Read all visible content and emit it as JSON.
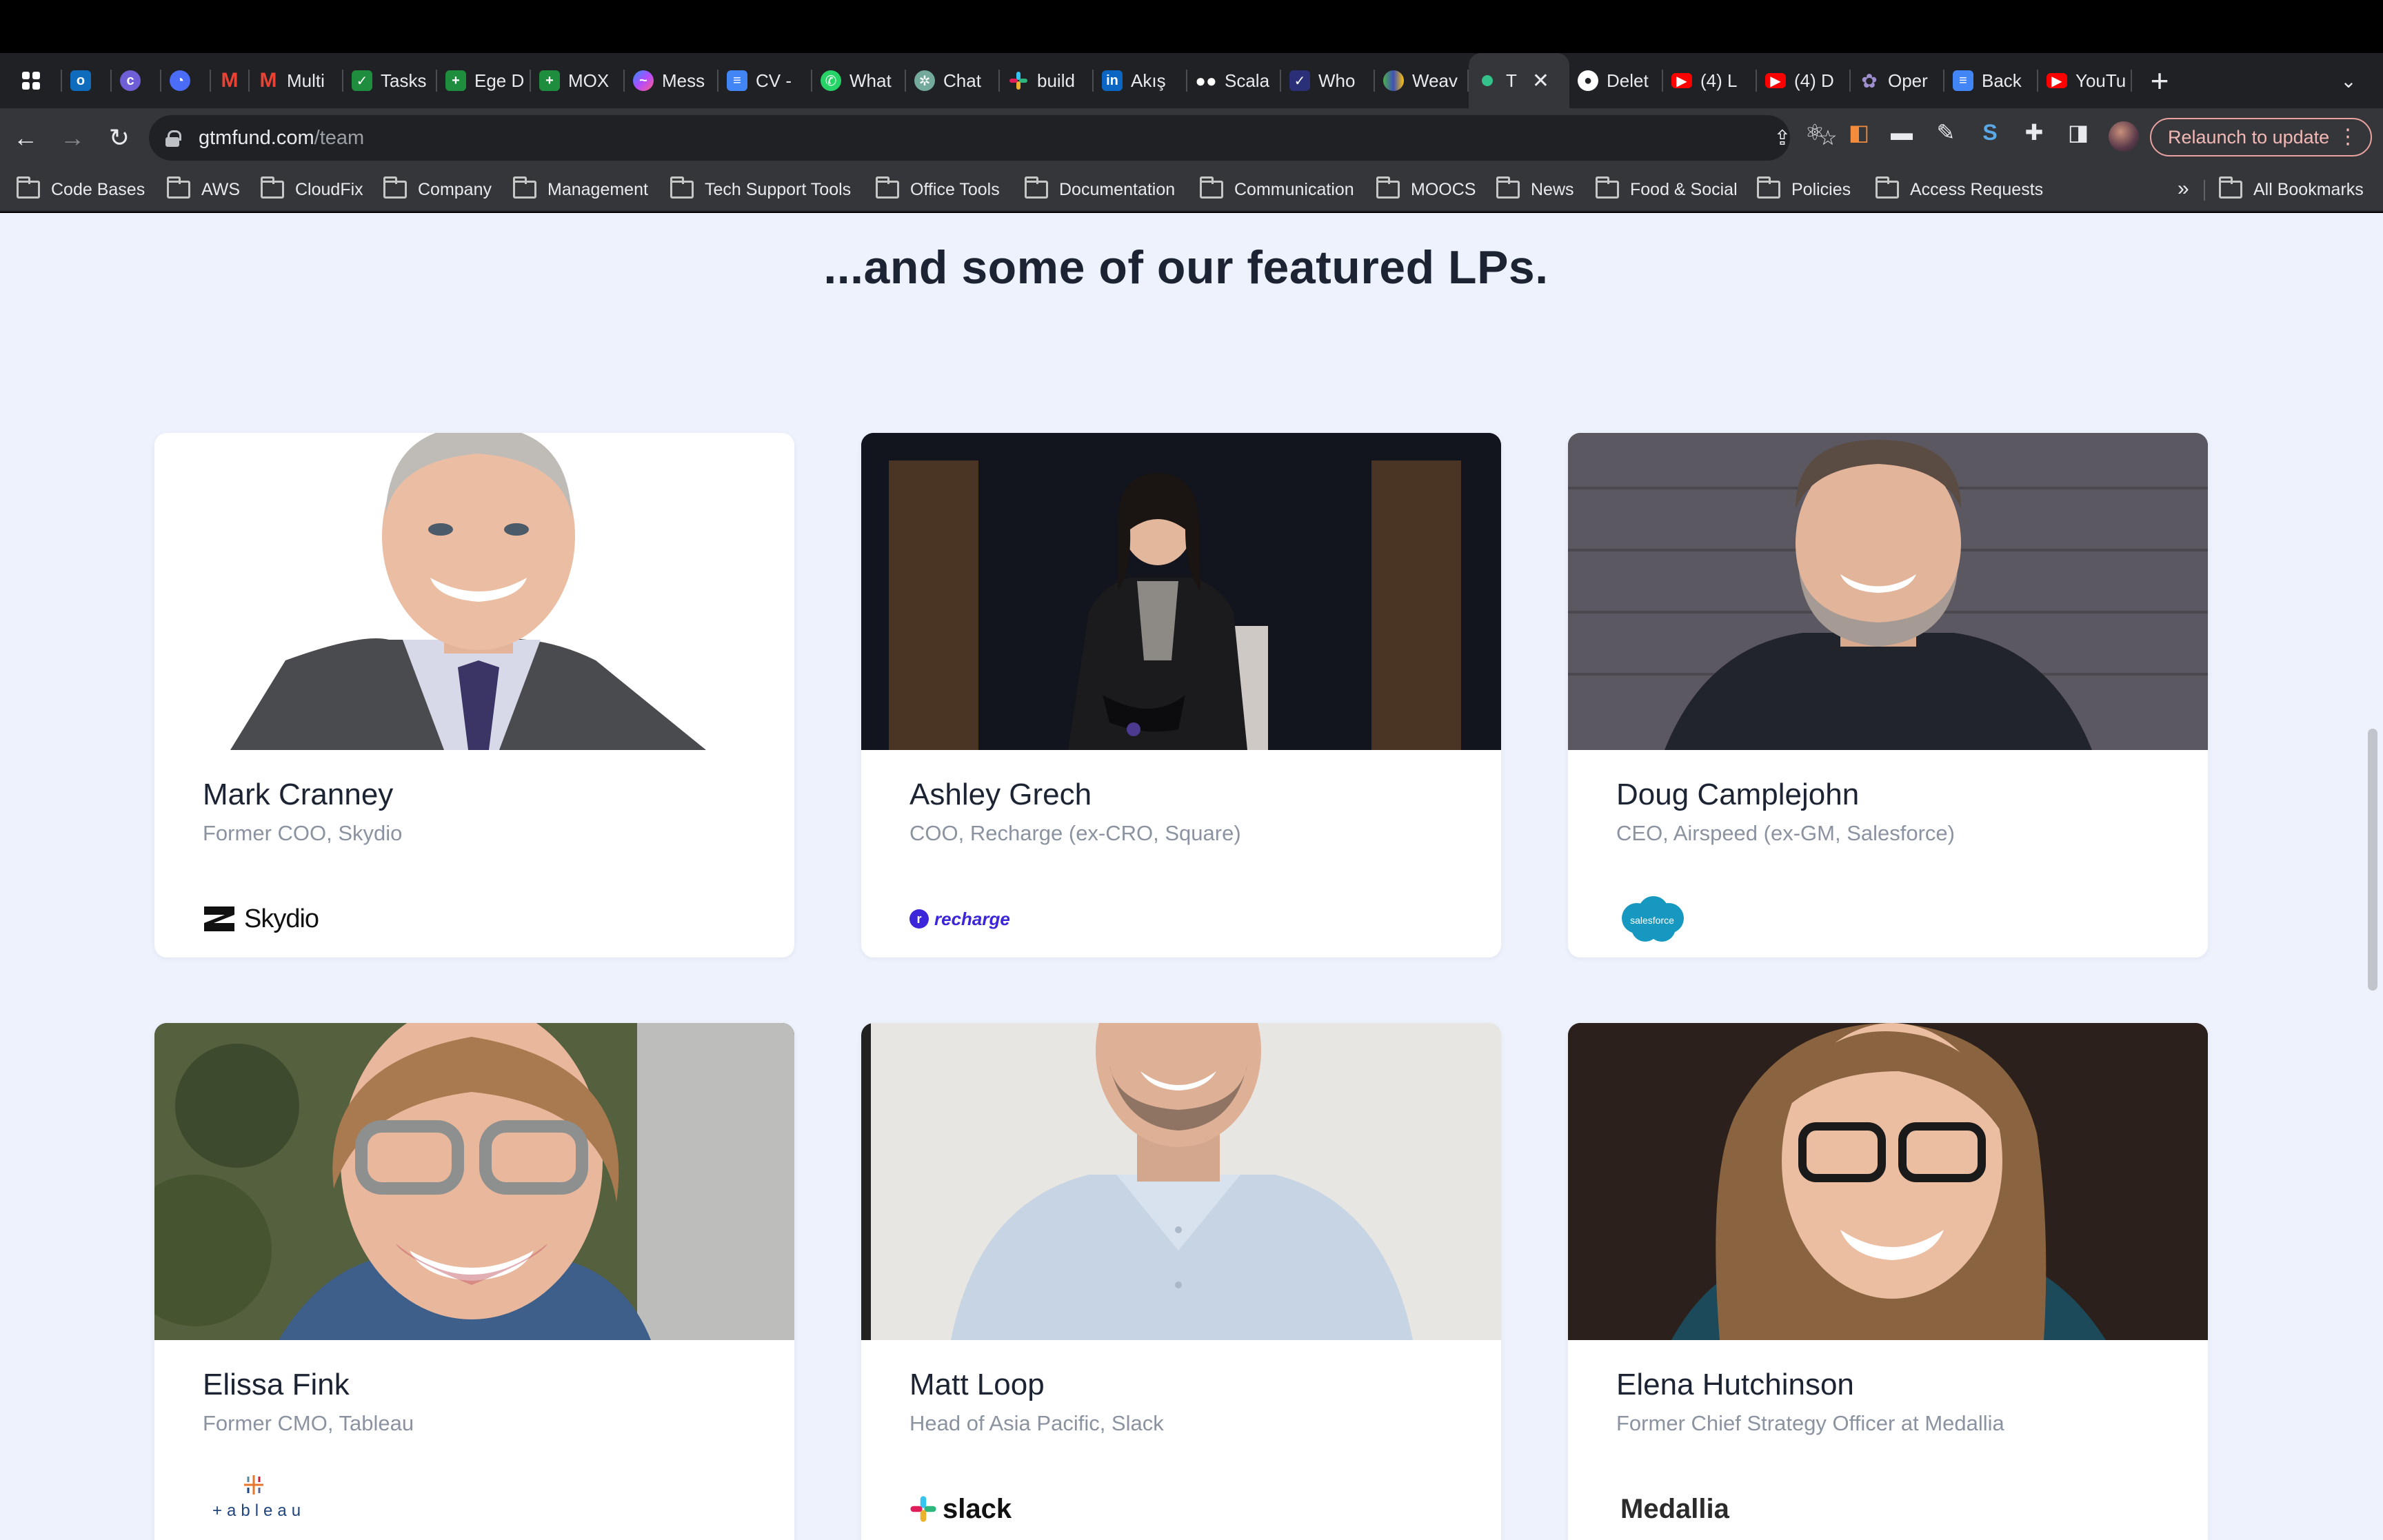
{
  "browser": {
    "tabs": [
      {
        "label": "",
        "icon": "apps-grid-icon",
        "color": "#ffffff"
      },
      {
        "label": "",
        "icon": "outlook-icon",
        "color": "#0f6cbd"
      },
      {
        "label": "",
        "icon": "circle-app-icon",
        "color": "#7b6cf0"
      },
      {
        "label": "",
        "icon": "clockify-icon",
        "color": "#4a6cf7"
      },
      {
        "label": "",
        "icon": "gmail-icon",
        "color": "#ea4335"
      },
      {
        "label": "Multi",
        "icon": "gmail-icon",
        "color": "#ea4335"
      },
      {
        "label": "Tasks",
        "icon": "sheets-tasks-icon",
        "color": "#1e8e3e"
      },
      {
        "label": "Ege D",
        "icon": "sheets-icon",
        "color": "#1e8e3e"
      },
      {
        "label": "MOX",
        "icon": "sheets-icon",
        "color": "#1e8e3e"
      },
      {
        "label": "Mess",
        "icon": "messenger-icon",
        "color": "#7b61ff"
      },
      {
        "label": "CV -",
        "icon": "docs-icon",
        "color": "#4285f4"
      },
      {
        "label": "What",
        "icon": "whatsapp-icon",
        "color": "#25d366"
      },
      {
        "label": "Chat",
        "icon": "chatgpt-icon",
        "color": "#74aa9c"
      },
      {
        "label": "build",
        "icon": "slack-icon",
        "color": "#e01e5a"
      },
      {
        "label": "Akış",
        "icon": "linkedin-icon",
        "color": "#0a66c2"
      },
      {
        "label": "Scala",
        "icon": "medium-icon",
        "color": "#ffffff"
      },
      {
        "label": "Who",
        "icon": "check-icon",
        "color": "#2b2f77"
      },
      {
        "label": "Weav",
        "icon": "weave-icon",
        "color": "#3f51b5"
      },
      {
        "label": "T",
        "icon": "gtm-dot-icon",
        "color": "#35c28a"
      },
      {
        "label": "Delet",
        "icon": "github-icon",
        "color": "#ffffff"
      },
      {
        "label": "(4) L",
        "icon": "youtube-icon",
        "color": "#ff0000"
      },
      {
        "label": "(4) D",
        "icon": "youtube-icon",
        "color": "#ff0000"
      },
      {
        "label": "Oper",
        "icon": "openai-icon",
        "color": "#a08fcf"
      },
      {
        "label": "Back",
        "icon": "docs-icon",
        "color": "#4285f4"
      },
      {
        "label": "YouTu",
        "icon": "youtube-icon",
        "color": "#ff0000"
      }
    ],
    "active_tab_index": 18,
    "url_host": "gtmfund.com",
    "url_path": "/team",
    "relaunch_label": "Relaunch to update",
    "bookmarks": [
      "Code Bases",
      "AWS",
      "CloudFix",
      "Company",
      "Management",
      "Tech Support Tools",
      "Office Tools",
      "Documentation",
      "Communication",
      "MOOCS",
      "News",
      "Food & Social",
      "Policies",
      "Access Requests"
    ],
    "bookmarks_more": "»",
    "all_bookmarks": "All Bookmarks"
  },
  "page": {
    "heading": "...and some of our featured LPs.",
    "accent_color": "#eef2fc",
    "lps": [
      {
        "name": "Mark Cranney",
        "role": "Former COO, Skydio",
        "logo": "Skydio",
        "logo_icon": "skydio-logo"
      },
      {
        "name": "Ashley Grech",
        "role": "COO, Recharge (ex-CRO, Square)",
        "logo": "recharge",
        "logo_icon": "recharge-logo"
      },
      {
        "name": "Doug Camplejohn",
        "role": "CEO, Airspeed (ex-GM, Salesforce)",
        "logo": "salesforce",
        "logo_icon": "salesforce-logo"
      },
      {
        "name": "Elissa Fink",
        "role": "Former CMO, Tableau",
        "logo": "+ableau",
        "logo_icon": "tableau-logo"
      },
      {
        "name": "Matt Loop",
        "role": "Head of Asia Pacific, Slack",
        "logo": "slack",
        "logo_icon": "slack-logo"
      },
      {
        "name": "Elena Hutchinson",
        "role": "Former Chief Strategy Officer at Medallia",
        "logo": "Medallia",
        "logo_icon": "medallia-logo"
      }
    ]
  }
}
